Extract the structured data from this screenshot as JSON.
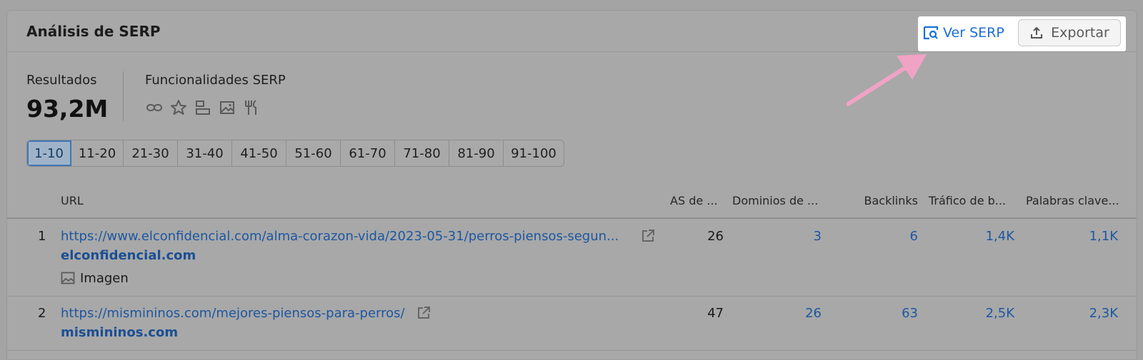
{
  "header": {
    "title": "Análisis de SERP",
    "ver_serp_label": "Ver SERP",
    "export_label": "Exportar"
  },
  "stats": {
    "results_label": "Resultados",
    "results_value": "93,2M",
    "features_label": "Funcionalidades SERP",
    "feature_icons": [
      "link-icon",
      "star-icon",
      "layout-icon",
      "image-icon",
      "fork-knife-icon"
    ]
  },
  "pagination": {
    "pages": [
      "1-10",
      "11-20",
      "21-30",
      "31-40",
      "41-50",
      "51-60",
      "61-70",
      "71-80",
      "81-90",
      "91-100"
    ],
    "active": "1-10"
  },
  "table": {
    "columns": {
      "url": "URL",
      "as": "AS de ...",
      "domains": "Dominios de ...",
      "backlinks": "Backlinks",
      "traffic": "Tráfico de b...",
      "keywords": "Palabras clave..."
    },
    "rows": [
      {
        "position": "1",
        "url": "https://www.elconfidencial.com/alma-corazon-vida/2023-05-31/perros-piensos-segun...",
        "domain": "elconfidencial.com",
        "feature": "Imagen",
        "as": "26",
        "domains": "3",
        "backlinks": "6",
        "traffic": "1,4K",
        "keywords": "1,1K"
      },
      {
        "position": "2",
        "url": "https://mismininos.com/mejores-piensos-para-perros/",
        "domain": "mismininos.com",
        "as": "47",
        "domains": "26",
        "backlinks": "63",
        "traffic": "2,5K",
        "keywords": "2,3K"
      }
    ]
  },
  "colors": {
    "link": "#1d57a0",
    "accent": "#1d6fd1",
    "arrow": "#f0a3c4",
    "highlight": "#ffffff"
  }
}
